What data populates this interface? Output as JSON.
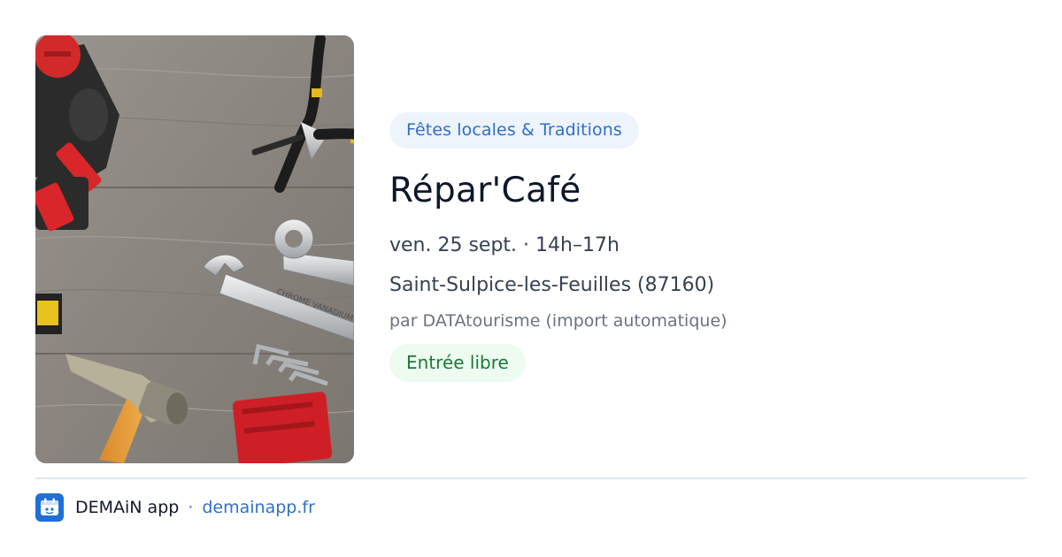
{
  "event": {
    "category": "Fêtes locales & Traditions",
    "title": "Répar'Café",
    "datetime": "ven. 25 sept. · 14h–17h",
    "location": "Saint-Sulpice-les-Feuilles (87160)",
    "source": "par DATAtourisme (import automatique)",
    "price": "Entrée libre"
  },
  "image": {
    "icon": "tools-photo",
    "wrench_engraving": "CHROME VANADIUM"
  },
  "footer": {
    "app_name": "DEMAiN app",
    "separator": "·",
    "link": "demainapp.fr",
    "logo_icon": "demain-logo-icon"
  },
  "colors": {
    "category_badge_bg": "#eef4fc",
    "category_badge_text": "#2f6fc9",
    "price_badge_bg": "#eefbf1",
    "price_badge_text": "#1b7a3a",
    "link": "#2f6fc9",
    "logo_bg": "#1f6fd8"
  }
}
